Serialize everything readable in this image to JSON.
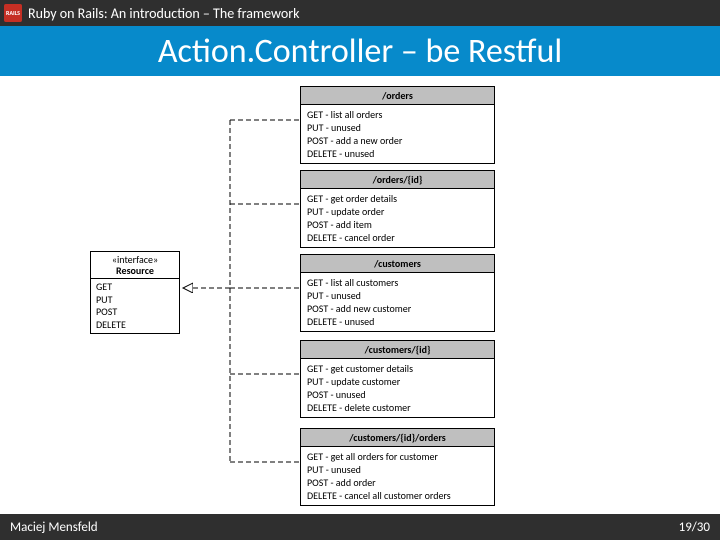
{
  "header": {
    "logo_text": "RAILS",
    "breadcrumb": "Ruby on Rails: An introduction – The framework"
  },
  "title": "Action.Controller – be Restful",
  "interface": {
    "stereotype": "«interface»",
    "name": "Resource",
    "methods": [
      "GET",
      "PUT",
      "POST",
      "DELETE"
    ]
  },
  "resources": [
    {
      "path": "/orders",
      "ops": [
        "GET - list all orders",
        "PUT - unused",
        "POST - add a new order",
        "DELETE - unused"
      ]
    },
    {
      "path": "/orders/{id}",
      "ops": [
        "GET - get order details",
        "PUT - update order",
        "POST - add item",
        "DELETE - cancel order"
      ]
    },
    {
      "path": "/customers",
      "ops": [
        "GET - list all customers",
        "PUT - unused",
        "POST - add new customer",
        "DELETE - unused"
      ]
    },
    {
      "path": "/customers/{id}",
      "ops": [
        "GET - get customer details",
        "PUT - update customer",
        "POST - unused",
        "DELETE - delete customer"
      ]
    },
    {
      "path": "/customers/{id}/orders",
      "ops": [
        "GET - get all orders for customer",
        "PUT - unused",
        "POST - add order",
        "DELETE - cancel all customer orders"
      ]
    }
  ],
  "footer": {
    "author": "Maciej Mensfeld",
    "page": "19/30"
  }
}
